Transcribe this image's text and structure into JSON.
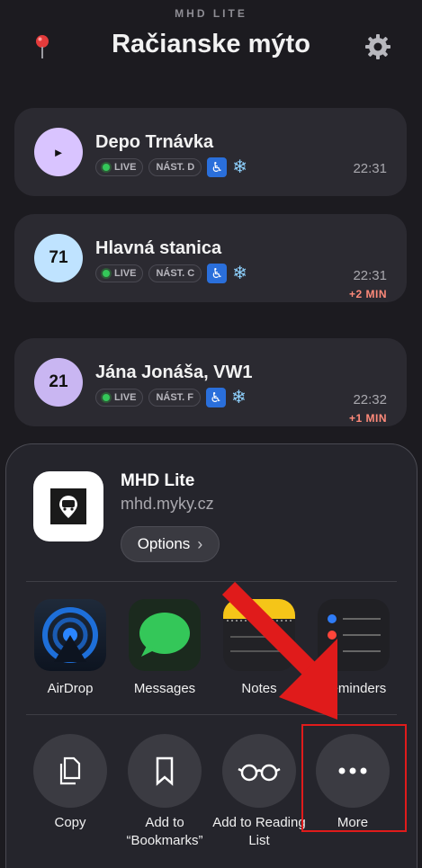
{
  "header": {
    "app_name": "MHD LITE",
    "stop_name": "Račianske mýto"
  },
  "departures": [
    {
      "line": "►",
      "destination": "Depo Trnávka",
      "live": "LIVE",
      "platform": "NÁST. D",
      "time": "22:31",
      "delay": "",
      "badge_color": "#d9c4ff"
    },
    {
      "line": "71",
      "destination": "Hlavná stanica",
      "live": "LIVE",
      "platform": "NÁST. C",
      "time": "22:31",
      "delay": "+2 MIN",
      "badge_color": "#bfe3ff"
    },
    {
      "line": "21",
      "destination": "Jána Jonáša, VW1",
      "live": "LIVE",
      "platform": "NÁST. F",
      "time": "22:32",
      "delay": "+1 MIN",
      "badge_color": "#c9b6f2"
    }
  ],
  "share_sheet": {
    "title": "MHD Lite",
    "url": "mhd.myky.cz",
    "options_label": "Options",
    "apps": [
      {
        "label": "AirDrop",
        "icon": "airdrop-icon"
      },
      {
        "label": "Messages",
        "icon": "messages-icon"
      },
      {
        "label": "Notes",
        "icon": "notes-icon"
      },
      {
        "label": "Reminders",
        "icon": "reminders-icon"
      }
    ],
    "actions": [
      {
        "label": "Copy",
        "icon": "copy-icon"
      },
      {
        "label": "Add to “Bookmarks”",
        "icon": "bookmark-icon"
      },
      {
        "label": "Add to Reading List",
        "icon": "glasses-icon"
      },
      {
        "label": "More",
        "icon": "more-icon"
      }
    ]
  },
  "colors": {
    "annotation": "#e01b1b",
    "live_dot": "#34c759",
    "delay": "#ff8a7a"
  }
}
